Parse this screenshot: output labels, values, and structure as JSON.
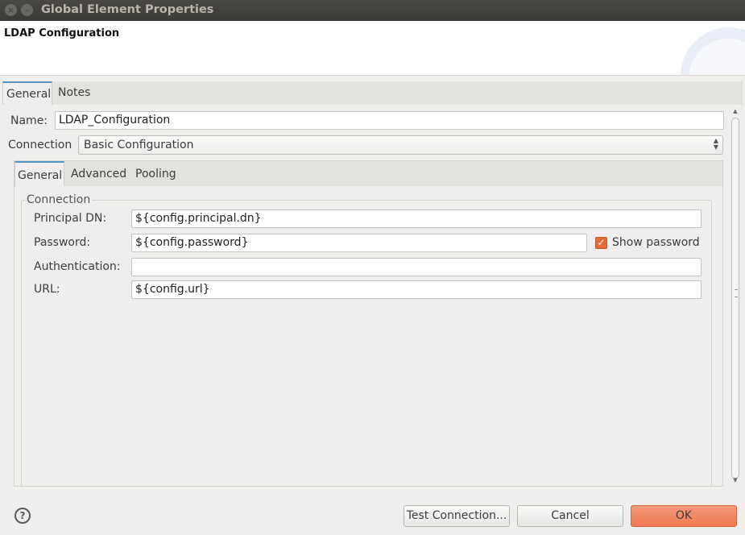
{
  "window": {
    "title": "Global Element Properties",
    "close_glyph": "×",
    "minimize_glyph": "–"
  },
  "banner": {
    "title": "LDAP Configuration"
  },
  "tabs": [
    {
      "label": "General"
    },
    {
      "label": "Notes"
    }
  ],
  "form": {
    "name_label": "Name:",
    "name_value": "LDAP_Configuration",
    "connection_label": "Connection",
    "connection_value": "Basic Configuration"
  },
  "subtabs": [
    {
      "label": "General"
    },
    {
      "label": "Advanced"
    },
    {
      "label": "Pooling"
    }
  ],
  "connection_group": {
    "title": "Connection",
    "principal_dn_label": "Principal DN:",
    "principal_dn_value": "${config.principal.dn}",
    "password_label": "Password:",
    "password_value": "${config.password}",
    "show_password_label": "Show password",
    "show_password_checked": true,
    "authentication_label": "Authentication:",
    "authentication_value": "",
    "url_label": "URL:",
    "url_value": "${config.url}"
  },
  "footer": {
    "help_glyph": "?",
    "test_connection_label": "Test Connection...",
    "cancel_label": "Cancel",
    "ok_label": "OK"
  },
  "colors": {
    "accent_tab": "#4f96c8",
    "ok_button": "#ee7850",
    "checkbox": "#e76a35"
  }
}
